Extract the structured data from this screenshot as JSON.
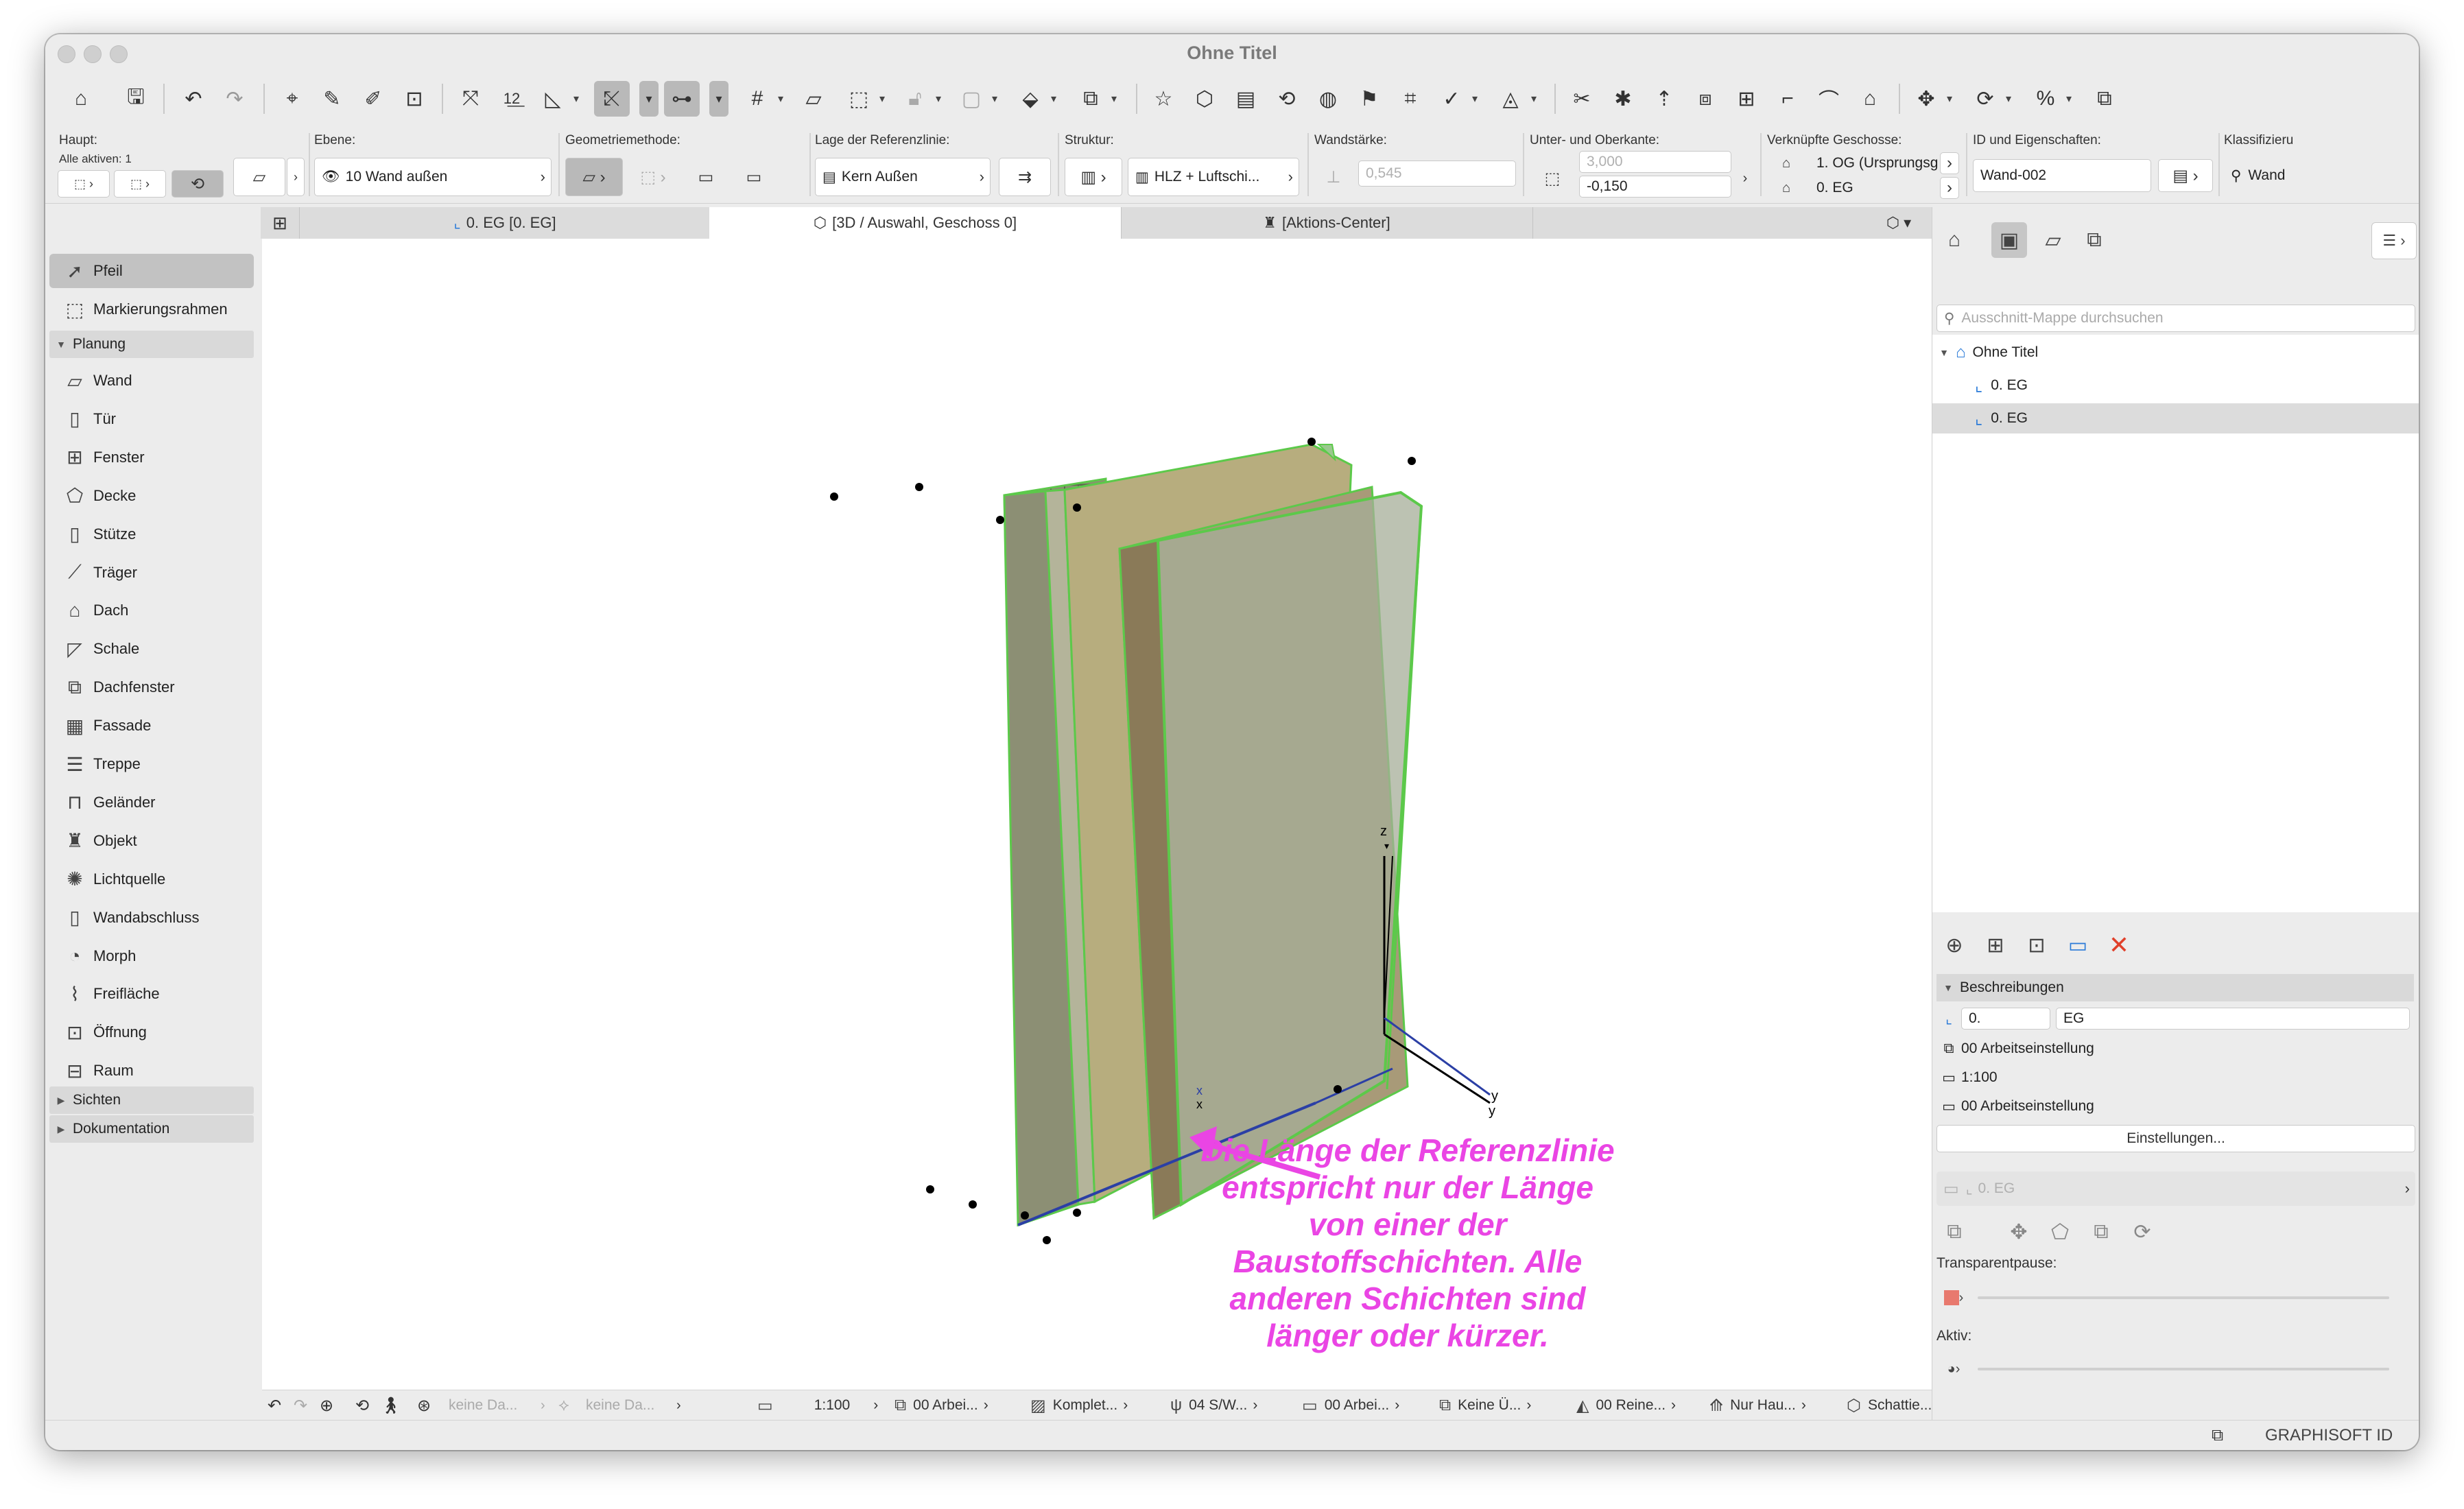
{
  "window": {
    "title": "Ohne Titel"
  },
  "toolbar": {
    "icons": [
      "home-icon",
      "save-icon",
      "undo-icon",
      "redo-icon",
      "pick-up-icon",
      "syringe-icon",
      "syringe-inject-icon",
      "magic-wand-icon",
      "trace-icon",
      "numbering-icon",
      "measure-icon",
      "guide-line-icon",
      "snap-guide-icon",
      "grid-icon",
      "snap-icon",
      "marquee-icon",
      "lock-icon",
      "group-icon",
      "render-icon",
      "layer-combo-icon",
      "favorites-icon",
      "3d-icon",
      "layout-icon",
      "teamwork-icon",
      "send-icon",
      "publish-icon",
      "tag-icon",
      "model-compare-icon",
      "morph-icon",
      "split-icon",
      "explode-icon",
      "elevate-icon",
      "offset-icon",
      "trim-icon",
      "fillet-icon",
      "roof-icon",
      "stretch-icon",
      "duplicate-icon",
      "percent-icon",
      "window-icon"
    ]
  },
  "infobox": {
    "haupt": {
      "label": "Haupt:",
      "all_active": "Alle aktiven: 1"
    },
    "ebene": {
      "label": "Ebene:",
      "value": "10 Wand außen"
    },
    "geometrie": {
      "label": "Geometriemethode:"
    },
    "referenzlinie": {
      "label": "Lage der Referenzlinie:",
      "value": "Kern Außen"
    },
    "struktur": {
      "label": "Struktur:",
      "value": "HLZ + Luftschi..."
    },
    "wandstaerke": {
      "label": "Wandstärke:",
      "value": "0,545"
    },
    "ober_unterkante": {
      "label": "Unter- und Oberkante:",
      "top": "3,000",
      "bottom": "-0,150"
    },
    "geschosse": {
      "label": "Verknüpfte Geschosse:",
      "top": "1. OG (Ursprungsg...",
      "bottom": "0. EG"
    },
    "id": {
      "label": "ID und Eigenschaften:",
      "value": "Wand-002"
    },
    "klassifizierung": {
      "label": "Klassifizieru",
      "value": "Wand"
    }
  },
  "tools": {
    "arrow": "Pfeil",
    "marquee": "Markierungsrahmen",
    "group_planung": "Planung",
    "items": [
      {
        "label": "Wand",
        "icon": "wall-icon"
      },
      {
        "label": "Tür",
        "icon": "door-icon"
      },
      {
        "label": "Fenster",
        "icon": "window-icon"
      },
      {
        "label": "Decke",
        "icon": "slab-icon"
      },
      {
        "label": "Stütze",
        "icon": "column-icon"
      },
      {
        "label": "Träger",
        "icon": "beam-icon"
      },
      {
        "label": "Dach",
        "icon": "roof-icon"
      },
      {
        "label": "Schale",
        "icon": "shell-icon"
      },
      {
        "label": "Dachfenster",
        "icon": "skylight-icon"
      },
      {
        "label": "Fassade",
        "icon": "curtain-wall-icon"
      },
      {
        "label": "Treppe",
        "icon": "stair-icon"
      },
      {
        "label": "Geländer",
        "icon": "railing-icon"
      },
      {
        "label": "Objekt",
        "icon": "object-icon"
      },
      {
        "label": "Lichtquelle",
        "icon": "lamp-icon"
      },
      {
        "label": "Wandabschluss",
        "icon": "wall-end-icon"
      },
      {
        "label": "Morph",
        "icon": "morph-icon"
      },
      {
        "label": "Freifläche",
        "icon": "mesh-icon"
      },
      {
        "label": "Öffnung",
        "icon": "opening-icon"
      },
      {
        "label": "Raum",
        "icon": "zone-icon"
      }
    ],
    "group_sichten": "Sichten",
    "group_dokumentation": "Dokumentation"
  },
  "tabs": [
    {
      "label": "0. EG [0. EG]",
      "icon": "floorplan-icon"
    },
    {
      "label": "[3D / Auswahl, Geschoss 0]",
      "icon": "3d-view-icon"
    },
    {
      "label": "[Aktions-Center]",
      "icon": "action-center-icon"
    }
  ],
  "viewport": {
    "annotation": [
      "Die Länge der Referenzlinie",
      "entspricht nur der Länge",
      "von einer der",
      "Baustoffschichten. Alle",
      "anderen Schichten sind",
      "länger oder kürzer."
    ],
    "axes": {
      "z": "z",
      "y": "y",
      "y2": "y",
      "x": "x",
      "x2": "x"
    },
    "annotation_color": "#ea45e4"
  },
  "statusbar": {
    "items": [
      {
        "label": "keine Da...",
        "disabled": true
      },
      {
        "label": "keine Da...",
        "disabled": true
      },
      {
        "label": "1:100"
      },
      {
        "label": "00 Arbei..."
      },
      {
        "label": "Komplet..."
      },
      {
        "label": "04 S/W..."
      },
      {
        "label": "00 Arbei..."
      },
      {
        "label": "Keine Ü..."
      },
      {
        "label": "00 Reine..."
      },
      {
        "label": "Nur Hau..."
      },
      {
        "label": "Schattie..."
      }
    ]
  },
  "navigator": {
    "search_placeholder": "Ausschnitt-Mappe durchsuchen",
    "tree": [
      {
        "label": "Ohne Titel"
      },
      {
        "label": "0. EG"
      },
      {
        "label": "0. EG"
      }
    ],
    "beschreibungen": "Beschreibungen",
    "field_id": "0.",
    "field_name": "EG",
    "row1": "00 Arbeitseinstellung",
    "row2": "1:100",
    "row3": "00 Arbeitseinstellung",
    "einstellungen": "Einstellungen...",
    "layout_value": "0. EG",
    "transparent": "Transparentpause:",
    "aktiv": "Aktiv:"
  },
  "footer": {
    "brand": "GRAPHISOFT ID"
  }
}
